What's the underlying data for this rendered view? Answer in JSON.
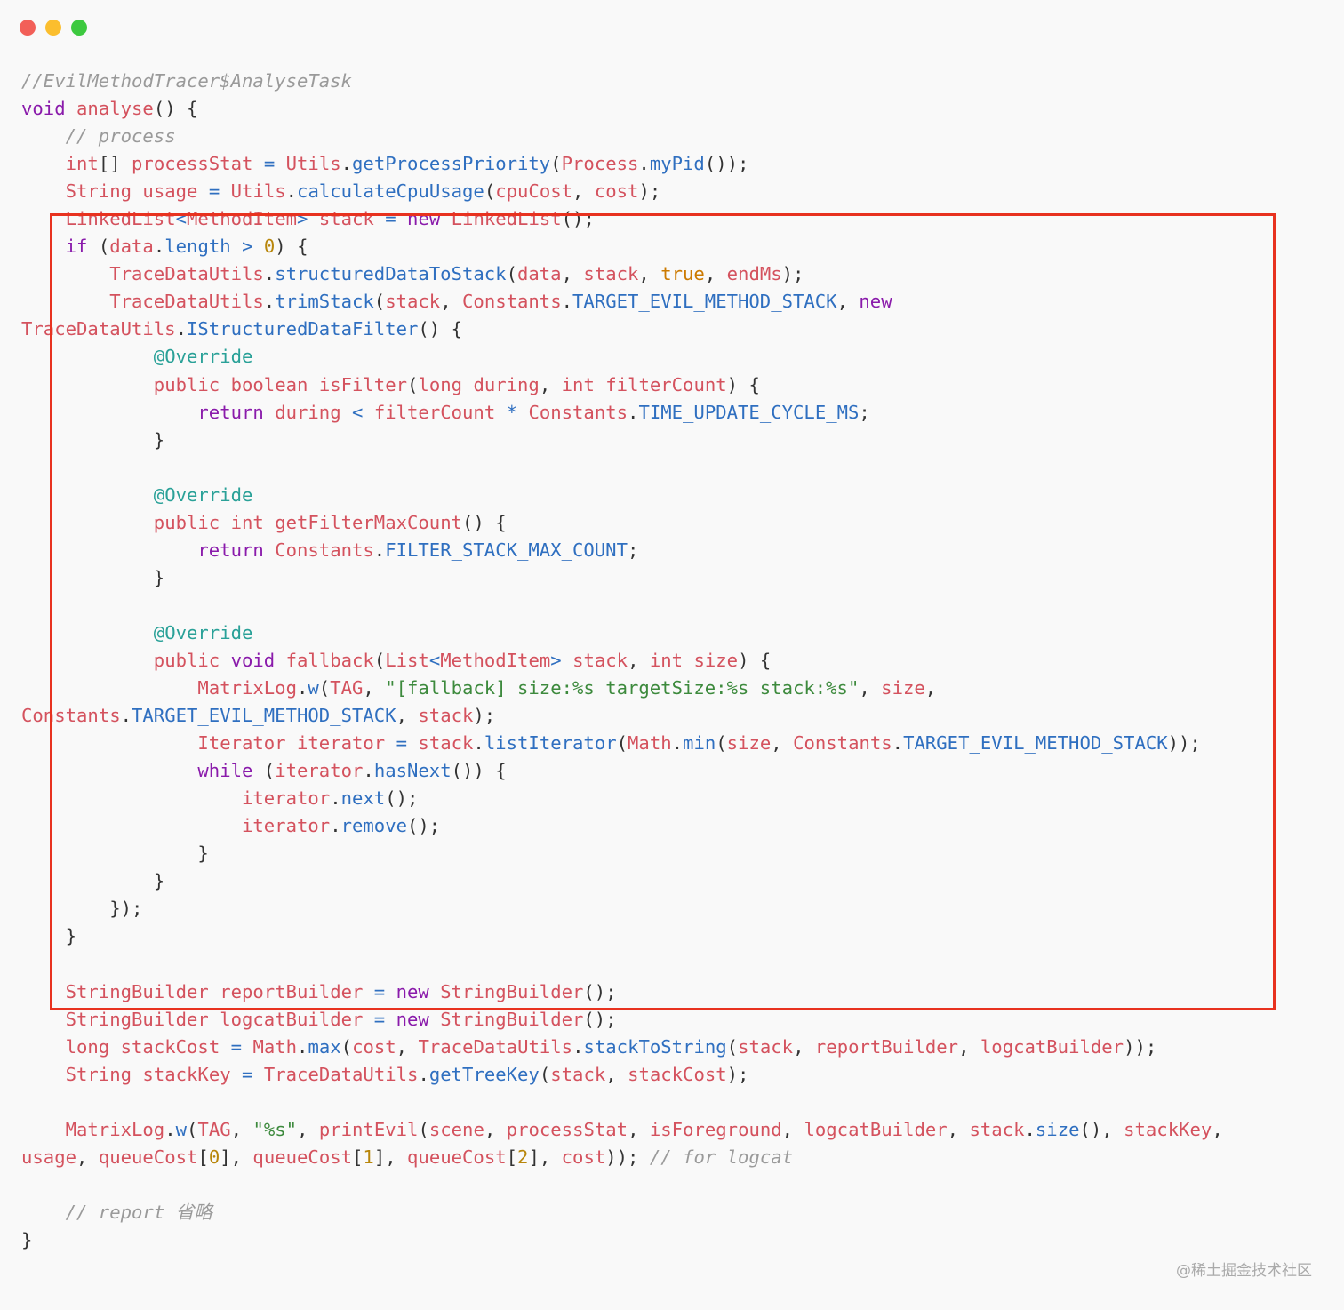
{
  "window": {
    "buttons": [
      {
        "name": "close",
        "color": "#f25f58"
      },
      {
        "name": "minimize",
        "color": "#fbbe2e"
      },
      {
        "name": "zoom",
        "color": "#3dc93f"
      }
    ]
  },
  "colors": {
    "keyword": "#8a1bab",
    "variable": "#d4525e",
    "function": "#2f6fc0",
    "string": "#3d8a3d",
    "number": "#b8860b",
    "annotation": "#2aa198",
    "comment": "#9a9a9a",
    "highlight_box": "#e8321f"
  },
  "code": {
    "lines": [
      [
        [
          "cm",
          "//EvilMethodTracer$AnalyseTask"
        ]
      ],
      [
        [
          "kw",
          "void"
        ],
        [
          "p",
          " "
        ],
        [
          "var",
          "analyse"
        ],
        [
          "p",
          "() {"
        ]
      ],
      [
        [
          "p",
          "    "
        ],
        [
          "cm",
          "// process"
        ]
      ],
      [
        [
          "p",
          "    "
        ],
        [
          "var",
          "int"
        ],
        [
          "p",
          "[] "
        ],
        [
          "var",
          "processStat"
        ],
        [
          "p",
          " "
        ],
        [
          "fn",
          "="
        ],
        [
          "p",
          " "
        ],
        [
          "var",
          "Utils"
        ],
        [
          "p",
          "."
        ],
        [
          "fn",
          "getProcessPriority"
        ],
        [
          "p",
          "("
        ],
        [
          "var",
          "Process"
        ],
        [
          "p",
          "."
        ],
        [
          "fn",
          "myPid"
        ],
        [
          "p",
          "());"
        ]
      ],
      [
        [
          "p",
          "    "
        ],
        [
          "var",
          "String"
        ],
        [
          "p",
          " "
        ],
        [
          "var",
          "usage"
        ],
        [
          "p",
          " "
        ],
        [
          "fn",
          "="
        ],
        [
          "p",
          " "
        ],
        [
          "var",
          "Utils"
        ],
        [
          "p",
          "."
        ],
        [
          "fn",
          "calculateCpuUsage"
        ],
        [
          "p",
          "("
        ],
        [
          "var",
          "cpuCost"
        ],
        [
          "p",
          ", "
        ],
        [
          "var",
          "cost"
        ],
        [
          "p",
          ");"
        ]
      ],
      [
        [
          "p",
          "    "
        ],
        [
          "var",
          "LinkedList"
        ],
        [
          "fn",
          "<"
        ],
        [
          "var",
          "MethodItem"
        ],
        [
          "fn",
          ">"
        ],
        [
          "p",
          " "
        ],
        [
          "var",
          "stack"
        ],
        [
          "p",
          " "
        ],
        [
          "fn",
          "="
        ],
        [
          "p",
          " "
        ],
        [
          "kw",
          "new"
        ],
        [
          "p",
          " "
        ],
        [
          "var",
          "LinkedList"
        ],
        [
          "p",
          "();"
        ]
      ],
      [
        [
          "p",
          "    "
        ],
        [
          "kw",
          "if"
        ],
        [
          "p",
          " ("
        ],
        [
          "var",
          "data"
        ],
        [
          "p",
          "."
        ],
        [
          "fn",
          "length"
        ],
        [
          "p",
          " "
        ],
        [
          "fn",
          ">"
        ],
        [
          "p",
          " "
        ],
        [
          "num",
          "0"
        ],
        [
          "p",
          ") {"
        ]
      ],
      [
        [
          "p",
          "        "
        ],
        [
          "var",
          "TraceDataUtils"
        ],
        [
          "p",
          "."
        ],
        [
          "fn",
          "structuredDataToStack"
        ],
        [
          "p",
          "("
        ],
        [
          "var",
          "data"
        ],
        [
          "p",
          ", "
        ],
        [
          "var",
          "stack"
        ],
        [
          "p",
          ", "
        ],
        [
          "bool",
          "true"
        ],
        [
          "p",
          ", "
        ],
        [
          "var",
          "endMs"
        ],
        [
          "p",
          ");"
        ]
      ],
      [
        [
          "p",
          "        "
        ],
        [
          "var",
          "TraceDataUtils"
        ],
        [
          "p",
          "."
        ],
        [
          "fn",
          "trimStack"
        ],
        [
          "p",
          "("
        ],
        [
          "var",
          "stack"
        ],
        [
          "p",
          ", "
        ],
        [
          "var",
          "Constants"
        ],
        [
          "p",
          "."
        ],
        [
          "fn",
          "TARGET_EVIL_METHOD_STACK"
        ],
        [
          "p",
          ", "
        ],
        [
          "kw",
          "new"
        ]
      ],
      [
        [
          "var",
          "TraceDataUtils"
        ],
        [
          "p",
          "."
        ],
        [
          "fn",
          "IStructuredDataFilter"
        ],
        [
          "p",
          "() {"
        ]
      ],
      [
        [
          "p",
          "            "
        ],
        [
          "ann",
          "@Override"
        ]
      ],
      [
        [
          "p",
          "            "
        ],
        [
          "var",
          "public"
        ],
        [
          "p",
          " "
        ],
        [
          "var",
          "boolean"
        ],
        [
          "p",
          " "
        ],
        [
          "var",
          "isFilter"
        ],
        [
          "p",
          "("
        ],
        [
          "var",
          "long"
        ],
        [
          "p",
          " "
        ],
        [
          "var",
          "during"
        ],
        [
          "p",
          ", "
        ],
        [
          "var",
          "int"
        ],
        [
          "p",
          " "
        ],
        [
          "var",
          "filterCount"
        ],
        [
          "p",
          ") {"
        ]
      ],
      [
        [
          "p",
          "                "
        ],
        [
          "kw",
          "return"
        ],
        [
          "p",
          " "
        ],
        [
          "var",
          "during"
        ],
        [
          "p",
          " "
        ],
        [
          "fn",
          "<"
        ],
        [
          "p",
          " "
        ],
        [
          "var",
          "filterCount"
        ],
        [
          "p",
          " "
        ],
        [
          "fn",
          "*"
        ],
        [
          "p",
          " "
        ],
        [
          "var",
          "Constants"
        ],
        [
          "p",
          "."
        ],
        [
          "fn",
          "TIME_UPDATE_CYCLE_MS"
        ],
        [
          "p",
          ";"
        ]
      ],
      [
        [
          "p",
          "            }"
        ]
      ],
      [
        [
          "p",
          ""
        ]
      ],
      [
        [
          "p",
          "            "
        ],
        [
          "ann",
          "@Override"
        ]
      ],
      [
        [
          "p",
          "            "
        ],
        [
          "var",
          "public"
        ],
        [
          "p",
          " "
        ],
        [
          "var",
          "int"
        ],
        [
          "p",
          " "
        ],
        [
          "var",
          "getFilterMaxCount"
        ],
        [
          "p",
          "() {"
        ]
      ],
      [
        [
          "p",
          "                "
        ],
        [
          "kw",
          "return"
        ],
        [
          "p",
          " "
        ],
        [
          "var",
          "Constants"
        ],
        [
          "p",
          "."
        ],
        [
          "fn",
          "FILTER_STACK_MAX_COUNT"
        ],
        [
          "p",
          ";"
        ]
      ],
      [
        [
          "p",
          "            }"
        ]
      ],
      [
        [
          "p",
          ""
        ]
      ],
      [
        [
          "p",
          "            "
        ],
        [
          "ann",
          "@Override"
        ]
      ],
      [
        [
          "p",
          "            "
        ],
        [
          "var",
          "public"
        ],
        [
          "p",
          " "
        ],
        [
          "kw",
          "void"
        ],
        [
          "p",
          " "
        ],
        [
          "var",
          "fallback"
        ],
        [
          "p",
          "("
        ],
        [
          "var",
          "List"
        ],
        [
          "fn",
          "<"
        ],
        [
          "var",
          "MethodItem"
        ],
        [
          "fn",
          ">"
        ],
        [
          "p",
          " "
        ],
        [
          "var",
          "stack"
        ],
        [
          "p",
          ", "
        ],
        [
          "var",
          "int"
        ],
        [
          "p",
          " "
        ],
        [
          "var",
          "size"
        ],
        [
          "p",
          ") {"
        ]
      ],
      [
        [
          "p",
          "                "
        ],
        [
          "var",
          "MatrixLog"
        ],
        [
          "p",
          "."
        ],
        [
          "fn",
          "w"
        ],
        [
          "p",
          "("
        ],
        [
          "var",
          "TAG"
        ],
        [
          "p",
          ", "
        ],
        [
          "str",
          "\"[fallback] size:%s targetSize:%s stack:%s\""
        ],
        [
          "p",
          ", "
        ],
        [
          "var",
          "size"
        ],
        [
          "p",
          ","
        ]
      ],
      [
        [
          "var",
          "Constants"
        ],
        [
          "p",
          "."
        ],
        [
          "fn",
          "TARGET_EVIL_METHOD_STACK"
        ],
        [
          "p",
          ", "
        ],
        [
          "var",
          "stack"
        ],
        [
          "p",
          ");"
        ]
      ],
      [
        [
          "p",
          "                "
        ],
        [
          "var",
          "Iterator"
        ],
        [
          "p",
          " "
        ],
        [
          "var",
          "iterator"
        ],
        [
          "p",
          " "
        ],
        [
          "fn",
          "="
        ],
        [
          "p",
          " "
        ],
        [
          "var",
          "stack"
        ],
        [
          "p",
          "."
        ],
        [
          "fn",
          "listIterator"
        ],
        [
          "p",
          "("
        ],
        [
          "var",
          "Math"
        ],
        [
          "p",
          "."
        ],
        [
          "fn",
          "min"
        ],
        [
          "p",
          "("
        ],
        [
          "var",
          "size"
        ],
        [
          "p",
          ", "
        ],
        [
          "var",
          "Constants"
        ],
        [
          "p",
          "."
        ],
        [
          "fn",
          "TARGET_EVIL_METHOD_STACK"
        ],
        [
          "p",
          "));"
        ]
      ],
      [
        [
          "p",
          "                "
        ],
        [
          "kw",
          "while"
        ],
        [
          "p",
          " ("
        ],
        [
          "var",
          "iterator"
        ],
        [
          "p",
          "."
        ],
        [
          "fn",
          "hasNext"
        ],
        [
          "p",
          "()) {"
        ]
      ],
      [
        [
          "p",
          "                    "
        ],
        [
          "var",
          "iterator"
        ],
        [
          "p",
          "."
        ],
        [
          "fn",
          "next"
        ],
        [
          "p",
          "();"
        ]
      ],
      [
        [
          "p",
          "                    "
        ],
        [
          "var",
          "iterator"
        ],
        [
          "p",
          "."
        ],
        [
          "fn",
          "remove"
        ],
        [
          "p",
          "();"
        ]
      ],
      [
        [
          "p",
          "                }"
        ]
      ],
      [
        [
          "p",
          "            }"
        ]
      ],
      [
        [
          "p",
          "        });"
        ]
      ],
      [
        [
          "p",
          "    }"
        ]
      ],
      [
        [
          "p",
          ""
        ]
      ],
      [
        [
          "p",
          "    "
        ],
        [
          "var",
          "StringBuilder"
        ],
        [
          "p",
          " "
        ],
        [
          "var",
          "reportBuilder"
        ],
        [
          "p",
          " "
        ],
        [
          "fn",
          "="
        ],
        [
          "p",
          " "
        ],
        [
          "kw",
          "new"
        ],
        [
          "p",
          " "
        ],
        [
          "var",
          "StringBuilder"
        ],
        [
          "p",
          "();"
        ]
      ],
      [
        [
          "p",
          "    "
        ],
        [
          "var",
          "StringBuilder"
        ],
        [
          "p",
          " "
        ],
        [
          "var",
          "logcatBuilder"
        ],
        [
          "p",
          " "
        ],
        [
          "fn",
          "="
        ],
        [
          "p",
          " "
        ],
        [
          "kw",
          "new"
        ],
        [
          "p",
          " "
        ],
        [
          "var",
          "StringBuilder"
        ],
        [
          "p",
          "();"
        ]
      ],
      [
        [
          "p",
          "    "
        ],
        [
          "var",
          "long"
        ],
        [
          "p",
          " "
        ],
        [
          "var",
          "stackCost"
        ],
        [
          "p",
          " "
        ],
        [
          "fn",
          "="
        ],
        [
          "p",
          " "
        ],
        [
          "var",
          "Math"
        ],
        [
          "p",
          "."
        ],
        [
          "fn",
          "max"
        ],
        [
          "p",
          "("
        ],
        [
          "var",
          "cost"
        ],
        [
          "p",
          ", "
        ],
        [
          "var",
          "TraceDataUtils"
        ],
        [
          "p",
          "."
        ],
        [
          "fn",
          "stackToString"
        ],
        [
          "p",
          "("
        ],
        [
          "var",
          "stack"
        ],
        [
          "p",
          ", "
        ],
        [
          "var",
          "reportBuilder"
        ],
        [
          "p",
          ", "
        ],
        [
          "var",
          "logcatBuilder"
        ],
        [
          "p",
          "));"
        ]
      ],
      [
        [
          "p",
          "    "
        ],
        [
          "var",
          "String"
        ],
        [
          "p",
          " "
        ],
        [
          "var",
          "stackKey"
        ],
        [
          "p",
          " "
        ],
        [
          "fn",
          "="
        ],
        [
          "p",
          " "
        ],
        [
          "var",
          "TraceDataUtils"
        ],
        [
          "p",
          "."
        ],
        [
          "fn",
          "getTreeKey"
        ],
        [
          "p",
          "("
        ],
        [
          "var",
          "stack"
        ],
        [
          "p",
          ", "
        ],
        [
          "var",
          "stackCost"
        ],
        [
          "p",
          ");"
        ]
      ],
      [
        [
          "p",
          ""
        ]
      ],
      [
        [
          "p",
          "    "
        ],
        [
          "var",
          "MatrixLog"
        ],
        [
          "p",
          "."
        ],
        [
          "fn",
          "w"
        ],
        [
          "p",
          "("
        ],
        [
          "var",
          "TAG"
        ],
        [
          "p",
          ", "
        ],
        [
          "str",
          "\"%s\""
        ],
        [
          "p",
          ", "
        ],
        [
          "var",
          "printEvil"
        ],
        [
          "p",
          "("
        ],
        [
          "var",
          "scene"
        ],
        [
          "p",
          ", "
        ],
        [
          "var",
          "processStat"
        ],
        [
          "p",
          ", "
        ],
        [
          "var",
          "isForeground"
        ],
        [
          "p",
          ", "
        ],
        [
          "var",
          "logcatBuilder"
        ],
        [
          "p",
          ", "
        ],
        [
          "var",
          "stack"
        ],
        [
          "p",
          "."
        ],
        [
          "fn",
          "size"
        ],
        [
          "p",
          "(), "
        ],
        [
          "var",
          "stackKey"
        ],
        [
          "p",
          ","
        ]
      ],
      [
        [
          "var",
          "usage"
        ],
        [
          "p",
          ", "
        ],
        [
          "var",
          "queueCost"
        ],
        [
          "p",
          "["
        ],
        [
          "num",
          "0"
        ],
        [
          "p",
          "], "
        ],
        [
          "var",
          "queueCost"
        ],
        [
          "p",
          "["
        ],
        [
          "num",
          "1"
        ],
        [
          "p",
          "], "
        ],
        [
          "var",
          "queueCost"
        ],
        [
          "p",
          "["
        ],
        [
          "num",
          "2"
        ],
        [
          "p",
          "], "
        ],
        [
          "var",
          "cost"
        ],
        [
          "p",
          "));"
        ],
        [
          "p",
          " "
        ],
        [
          "cm",
          "// for logcat"
        ]
      ],
      [
        [
          "p",
          ""
        ]
      ],
      [
        [
          "p",
          "    "
        ],
        [
          "cm",
          "// report 省略"
        ]
      ],
      [
        [
          "p",
          "}"
        ]
      ]
    ]
  },
  "watermark": "@稀土掘金技术社区"
}
